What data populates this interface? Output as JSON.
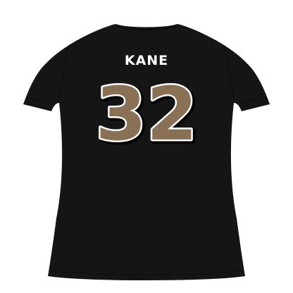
{
  "product": {
    "name": "KANE",
    "number": "32"
  },
  "colors": {
    "background": "#ffffff",
    "shirt": "#151515",
    "shirt_shade": "#0d0d0d",
    "name_text": "#ffffff",
    "number_fill": "#8a7055",
    "number_outline": "#ffffff",
    "number_shadow": "#000000"
  }
}
